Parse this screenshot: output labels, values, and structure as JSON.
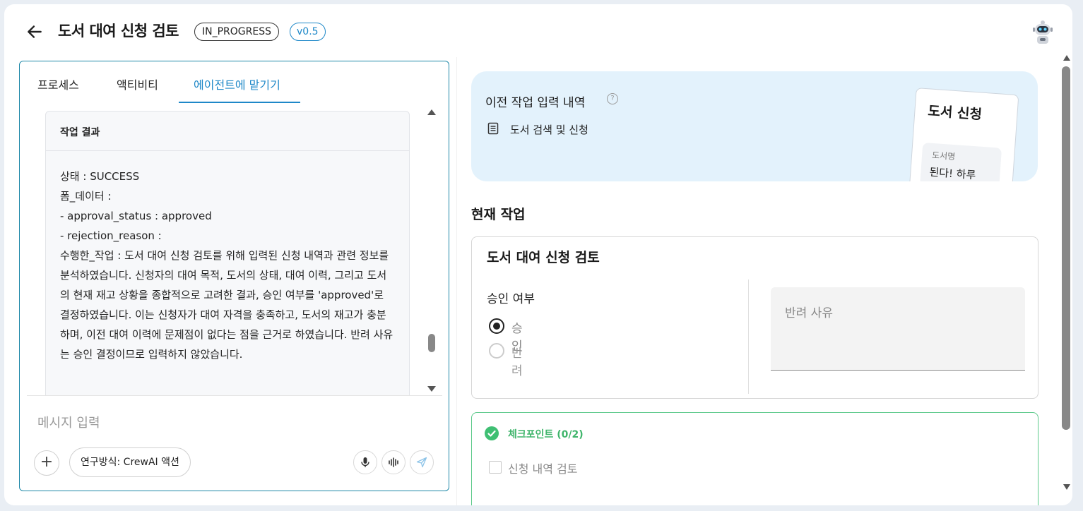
{
  "header": {
    "title": "도서 대여 신청 검토",
    "status_badge": "IN_PROGRESS",
    "version_badge": "v0.5"
  },
  "left_panel": {
    "tabs": [
      {
        "label": "프로세스",
        "active": false
      },
      {
        "label": "액티비티",
        "active": false
      },
      {
        "label": "에이전트에 맡기기",
        "active": true
      }
    ],
    "result_card": {
      "title": "작업 결과",
      "lines": [
        "상태 : SUCCESS",
        "폼_데이터 :",
        "- approval_status : approved",
        "- rejection_reason :",
        "수행한_작업 : 도서 대여 신청 검토를 위해 입력된 신청 내역과 관련 정보를 분석하였습니다. 신청자의 대여 목적, 도서의 상태, 대여 이력, 그리고 도서의 현재 재고 상황을 종합적으로 고려한 결과, 승인 여부를 'approved'로 결정하였습니다. 이는 신청자가 대여 자격을 충족하고, 도서의 재고가 충분하며, 이전 대여 이력에 문제점이 없다는 점을 근거로 하였습니다. 반려 사유는 승인 결정이므로 입력하지 않았습니다."
      ]
    },
    "message_input": {
      "placeholder": "메시지 입력",
      "value": ""
    },
    "mode_chip": "연구방식: CrewAI 액션"
  },
  "right_panel": {
    "previous_inputs": {
      "title": "이전 작업 입력 내역",
      "item": "도서 검색 및 신청",
      "preview_card": {
        "title": "도서 신청",
        "field_label": "도서명",
        "field_value": "된다! 하루"
      }
    },
    "current_task_heading": "현재 작업",
    "task_form": {
      "title": "도서 대여 신청 검토",
      "approval_label": "승인 여부",
      "options": [
        {
          "label": "승인",
          "selected": true
        },
        {
          "label": "반려",
          "selected": false
        }
      ],
      "rejection_placeholder": "반려 사유"
    },
    "checkpoints": {
      "title": "체크포인트 (0/2)",
      "items": [
        {
          "label": "신청 내역 검토",
          "checked": false
        }
      ]
    }
  },
  "colors": {
    "accent": "#1e88c8",
    "checkpoint_green": "#3fbf73",
    "prev_box_bg": "#e3f2fc"
  }
}
